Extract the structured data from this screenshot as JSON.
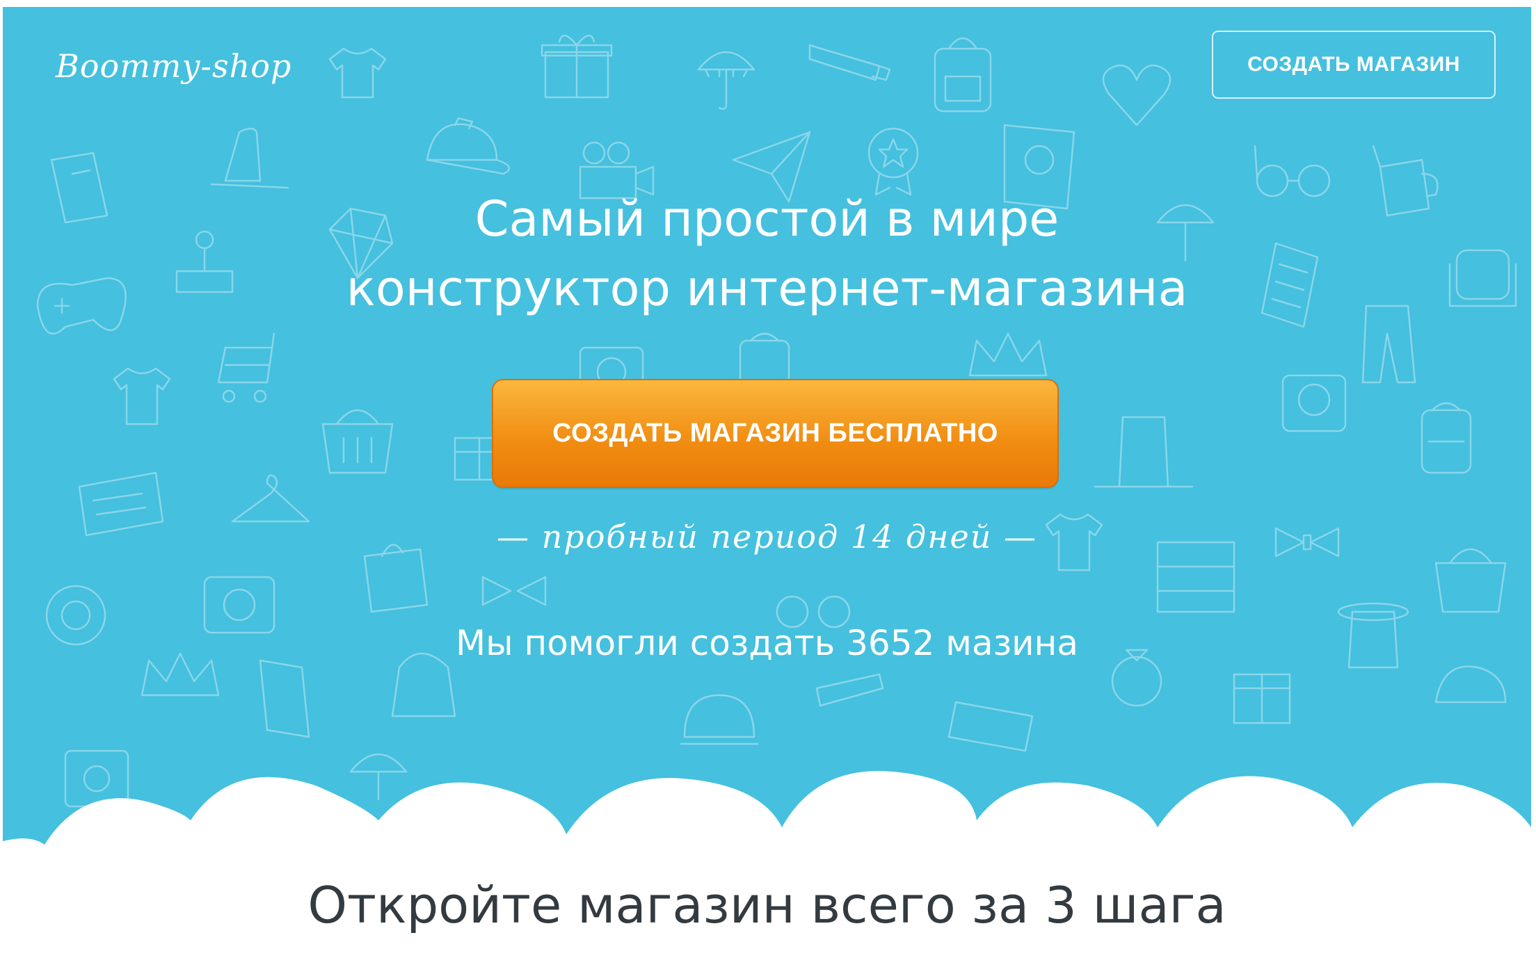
{
  "header": {
    "logo_text": "Boommy-shop",
    "create_store_button": "СОЗДАТЬ МАГАЗИН"
  },
  "hero": {
    "headline_line1": "Самый простой в мире",
    "headline_line2": "конструктор интернет-магазина",
    "cta_button": "СОЗДАТЬ МАГАЗИН БЕСПЛАТНО",
    "trial_note": "— пробный период 14 дней —",
    "stores_helped": "Мы помогли создать 3652 мазина"
  },
  "steps": {
    "title": "Откройте магазин всего за 3 шага"
  },
  "colors": {
    "hero_background": "#45c0de",
    "cta_orange": "#f08b10",
    "doodle_stroke": "#8ad6ea",
    "text_dark": "#333a40"
  },
  "icons": [
    "t-shirt-icon",
    "gift-icon",
    "umbrella-icon",
    "tie-icon",
    "backpack-icon",
    "heart-icon",
    "book-icon",
    "hat-icon",
    "cap-icon",
    "paper-plane-icon",
    "camera-icon",
    "badge-icon",
    "glasses-icon",
    "diamond-icon",
    "joystick-icon",
    "gamepad-icon",
    "cart-icon",
    "basket-icon",
    "crown-icon",
    "hanger-icon",
    "bow-tie-icon",
    "lifebuoy-icon",
    "ring-icon",
    "dresser-icon",
    "armchair-icon",
    "receipt-icon",
    "trousers-icon",
    "cup-icon"
  ]
}
